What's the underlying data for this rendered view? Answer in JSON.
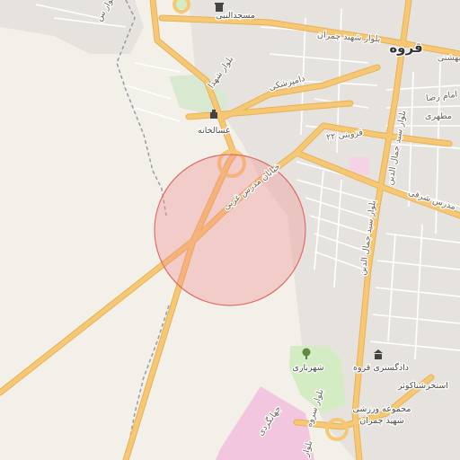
{
  "map": {
    "city_label": "قروه",
    "poi": {
      "mosque": "مسجدالنبی",
      "morgue": "غسالخانه",
      "municipality": "شهرباری",
      "courthouse": "دادگستری قروه",
      "pool": "استخرشناکوثر",
      "sports_complex_line1": "مجموعه ورزشی",
      "sports_complex_line2": "شهید چمران"
    },
    "roads": {
      "chamran_blvd": "بلوار شهید چمران",
      "shohada_blvd": "بلوار شهدا",
      "damparshki": "دامپزشکی",
      "qazvin_22": "۲۲ قزوینی",
      "modares_west": "خیابان مدرس غربی",
      "modares_east": "مدرس شرقی",
      "jamaleddin_blvd": "بلوار سید جمال الدین",
      "jamaleddin_blvd_2": "بلوار سید جمال الدین",
      "jahangardi": "جهانگردی",
      "sorkh_blvd": "بلوار سروه",
      "emam_reza": "امام رضا",
      "motahari": "مطهری",
      "beheshti": "بهشتی",
      "partial_road": "بلوار",
      "sahar": "بلوار س"
    },
    "highlight_circle_color": "#f28a8a",
    "major_road_color": "#f7c873",
    "minor_road_color": "#ffffff",
    "park_color": "#d3ecc4",
    "block_color": "#e5e2dd",
    "pink_area_color": "#f3c6df"
  }
}
